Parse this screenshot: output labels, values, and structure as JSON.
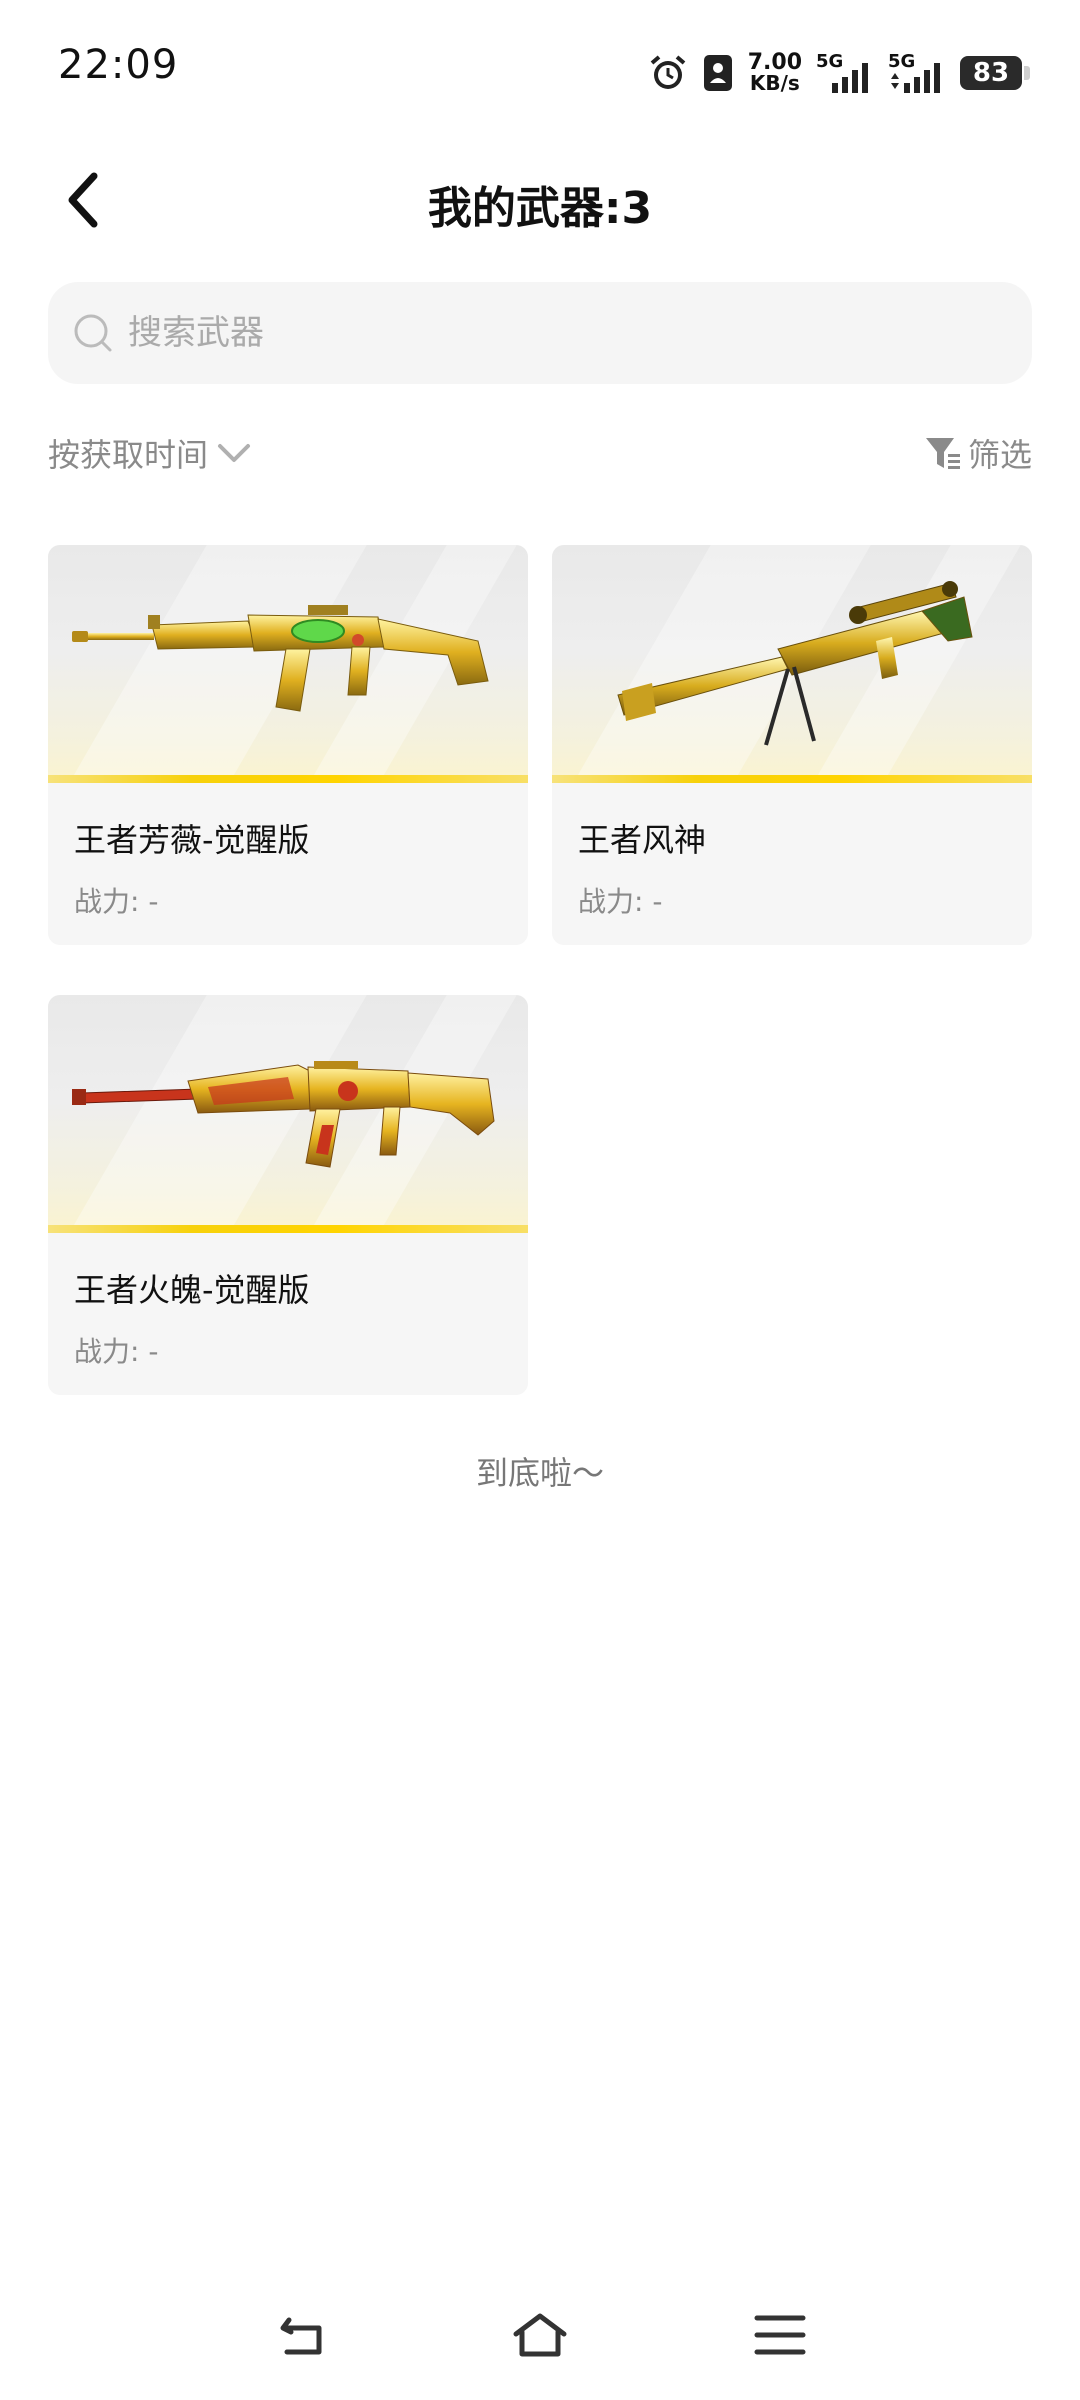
{
  "status_bar": {
    "time": "22:09",
    "net_speed_value": "7.00",
    "net_speed_unit": "KB/s",
    "sim1_label": "5G",
    "sim2_label": "5G",
    "battery": "83",
    "icons": [
      "alarm-icon",
      "contact-card-icon",
      "signal-icon",
      "signal-icon",
      "battery-icon"
    ]
  },
  "header": {
    "title": "我的武器:3",
    "back_icon": "chevron-left-icon"
  },
  "search": {
    "placeholder": "搜索武器",
    "value": "",
    "icon": "search-icon"
  },
  "sort": {
    "label": "按获取时间",
    "icon": "chevron-down-icon"
  },
  "filter": {
    "label": "筛选",
    "icon": "filter-icon"
  },
  "weapons": [
    {
      "name": "王者芳薇-觉醒版",
      "power": "战力: -",
      "image": "golden-assault-rifle"
    },
    {
      "name": "王者风神",
      "power": "战力: -",
      "image": "golden-sniper-rifle"
    },
    {
      "name": "王者火魄-觉醒版",
      "power": "战力: -",
      "image": "golden-red-rifle"
    }
  ],
  "end_text": "到底啦～",
  "navbar": {
    "icons": [
      "back-nav-icon",
      "home-nav-icon",
      "menu-nav-icon"
    ]
  },
  "colors": {
    "accent_yellow": "#f7d10b",
    "text_primary": "#111111",
    "text_secondary": "#8a8a8a",
    "card_bg": "#f6f6f6"
  }
}
